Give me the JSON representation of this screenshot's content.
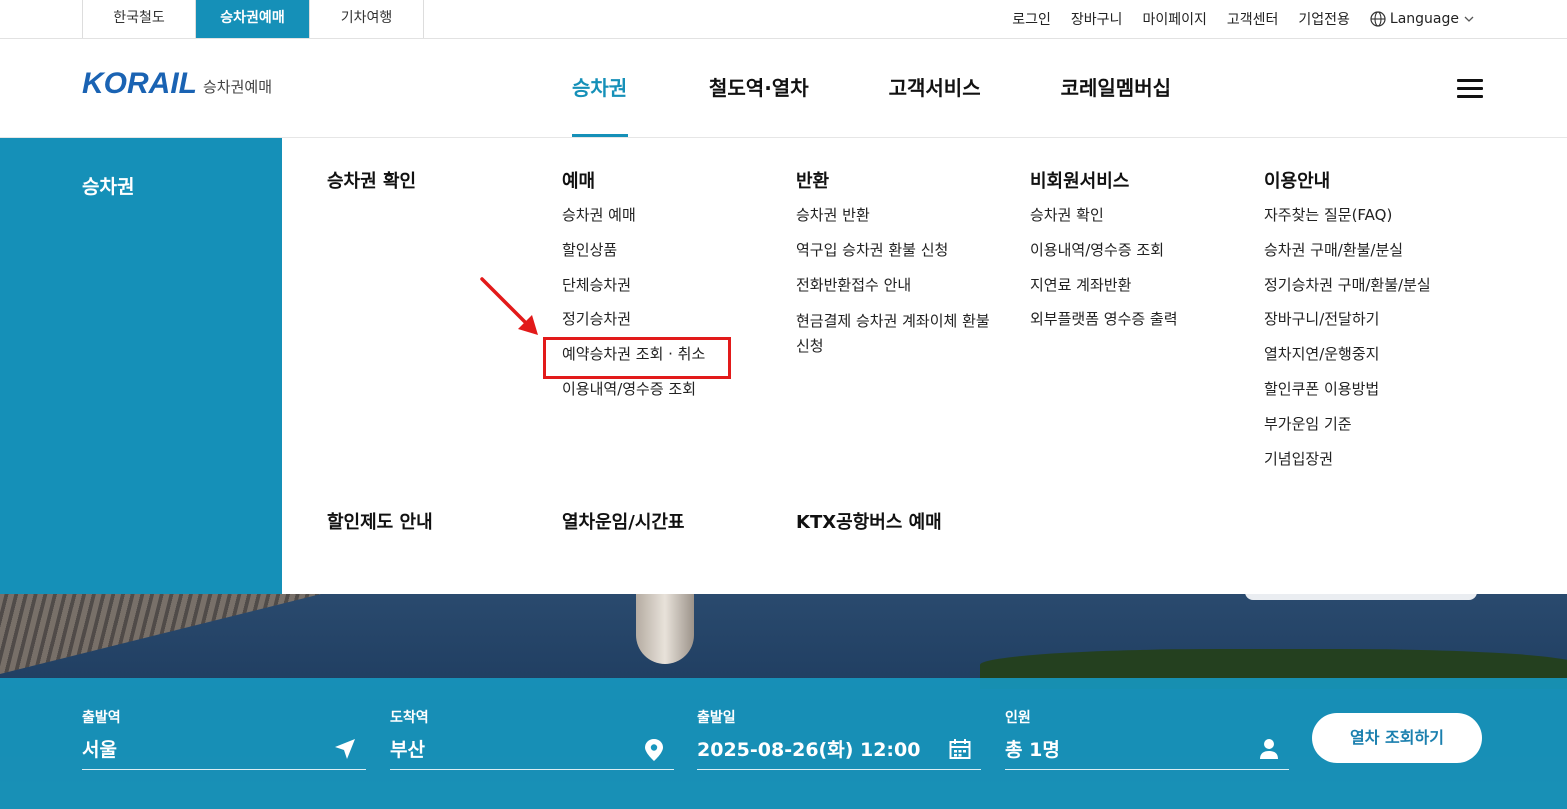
{
  "util_bar": {
    "tabs": [
      {
        "label": "한국철도"
      },
      {
        "label": "승차권예매"
      },
      {
        "label": "기차여행"
      }
    ],
    "links": [
      "로그인",
      "장바구니",
      "마이페이지",
      "고객센터",
      "기업전용"
    ],
    "language_label": "Language"
  },
  "header": {
    "logo_text": "KORAIL",
    "logo_sub": "승차권예매",
    "nav": [
      "승차권",
      "철도역·열차",
      "고객서비스",
      "코레일멤버십"
    ],
    "nav_active_index": 0
  },
  "mega_menu": {
    "side_title": "승차권",
    "columns": [
      {
        "title": "승차권 확인",
        "items": []
      },
      {
        "title": "예매",
        "items": [
          "승차권 예매",
          "할인상품",
          "단체승차권",
          "정기승차권",
          "예약승차권 조회 · 취소",
          "이용내역/영수증 조회"
        ]
      },
      {
        "title": "반환",
        "items": [
          "승차권 반환",
          "역구입 승차권 환불 신청",
          "전화반환접수 안내",
          "현금결제 승차권 계좌이체 환불 신청"
        ]
      },
      {
        "title": "비회원서비스",
        "items": [
          "승차권 확인",
          "이용내역/영수증 조회",
          "지연료 계좌반환",
          "외부플랫폼 영수증 출력"
        ]
      },
      {
        "title": "이용안내",
        "items": [
          "자주찾는 질문(FAQ)",
          "승차권 구매/환불/분실",
          "정기승차권 구매/환불/분실",
          "장바구니/전달하기",
          "열차지연/운행중지",
          "할인쿠폰 이용방법",
          "부가운임 기준",
          "기념입장권"
        ]
      }
    ],
    "bottom_links": [
      "할인제도 안내",
      "열차운임/시간표",
      "KTX공항버스 예매"
    ],
    "highlighted_item": "예약승차권 조회 · 취소"
  },
  "search": {
    "departure": {
      "label": "출발역",
      "value": "서울"
    },
    "arrival": {
      "label": "도착역",
      "value": "부산"
    },
    "date": {
      "label": "출발일",
      "value": "2025-08-26(화) 12:00"
    },
    "passengers": {
      "label": "인원",
      "value": "총 1명"
    },
    "button_label": "열차 조회하기"
  },
  "colors": {
    "brand": "#1590b8",
    "highlight": "#e21a1a",
    "logo": "#1a63b3"
  }
}
